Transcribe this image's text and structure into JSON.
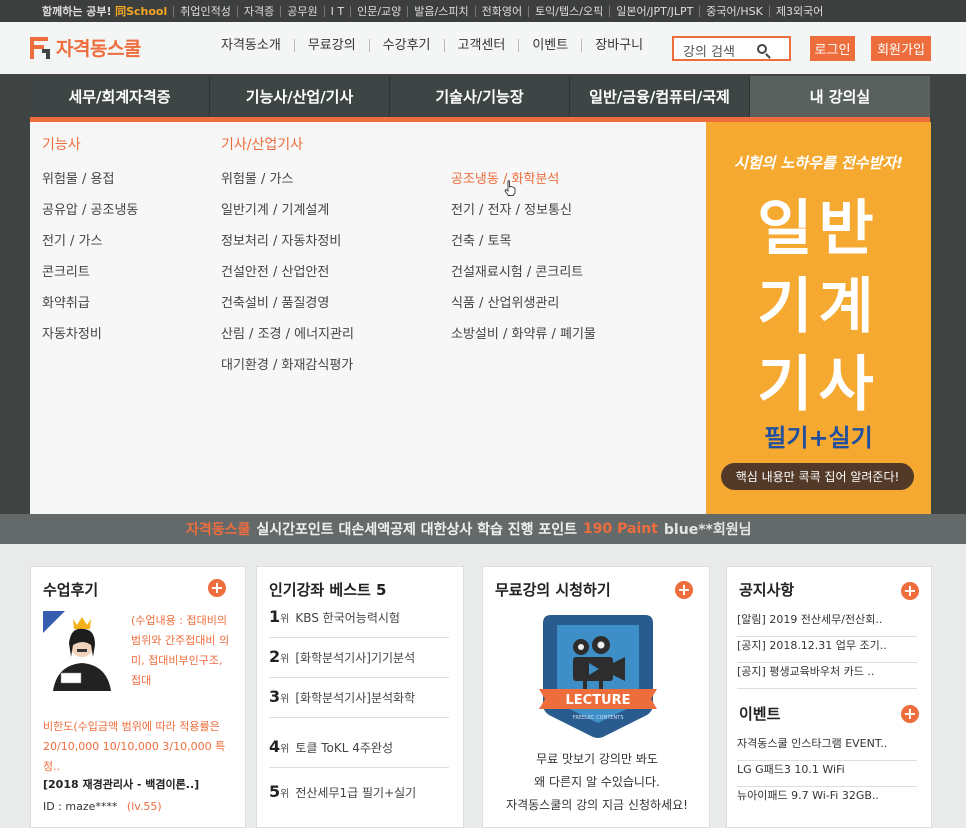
{
  "topbar": {
    "items": [
      "함께하는 공부!",
      "취업인적성",
      "자격증",
      "공무원",
      "I T",
      "인문/교양",
      "발음/스피치",
      "전화영어",
      "토익/텝스/오픽",
      "일본어/JPT/JLPT",
      "중국어/HSK",
      "제3외국어"
    ],
    "brand_hl": "同School"
  },
  "header": {
    "logo": "자격동스쿨",
    "gnb": [
      "자격동소개",
      "무료강의",
      "수강후기",
      "고객센터",
      "이벤트",
      "장바구니"
    ],
    "search_placeholder": "강의 검색",
    "login": "로그인",
    "join": "회원가입"
  },
  "categories": [
    "세무/회계자격증",
    "기능사/산업/기사",
    "기술사/기능장",
    "일반/금융/컴퓨터/국제",
    "내 강의실"
  ],
  "dropdown": {
    "col1_title": "기능사",
    "col1": [
      "위험물 / 용접",
      "공유압 / 공조냉동",
      "전기 / 가스",
      "콘크리트",
      "화약취급",
      "자동차정비"
    ],
    "col2_title": "기사/산업기사",
    "col2": [
      "위험물 / 가스",
      "일반기계 / 기계설계",
      "정보처리 / 자동차정비",
      "건설안전 / 산업안전",
      "건축설비 / 품질경영",
      "산림 / 조경 / 에너지관리",
      "대기환경 / 화재감식평가"
    ],
    "col3": [
      "공조냉동 / 화학분석",
      "전기 / 전자 / 정보통신",
      "건축 / 토목",
      "건설재료시험 / 콘크리트",
      "식품 / 산업위생관리",
      "소방설비 / 화약류 / 폐기물"
    ]
  },
  "banner": {
    "top": "시험의 노하우를 전수받자!",
    "big1": "일반",
    "big2": "기계",
    "big3": "기사",
    "sub": "필기+실기",
    "pill": "핵심 내용만 콕콕 집어 알려준다!"
  },
  "ticker": {
    "brand": "자격동스쿨",
    "text": "실시간포인트 대손세액공제 대한상사 학습 진행 포인트",
    "points": "190 Paint",
    "user": "blue**회원님"
  },
  "review": {
    "title": "수업후기",
    "text1": "(수업내용 : 접대비의 범위와 간주접대비 의미, 접대비부인구조, 접대",
    "text2": "비한도(수입금액 범위에 따라 적용률은20/10,000 10/10,000 3/10,000 특정..",
    "course": "[2018 재경관리사 - 백겸이론..]",
    "id": "ID : maze****",
    "level": "(lv.55)"
  },
  "best": {
    "title": "인기강좌 베스트 5",
    "rank_suffix": "위",
    "items": [
      {
        "rank": "1",
        "name": "KBS 한국어능력시험"
      },
      {
        "rank": "2",
        "name": "[화학분석기사]기기분석"
      },
      {
        "rank": "3",
        "name": "[화학분석기사]분석화학"
      },
      {
        "rank": "4",
        "name": "토클 ToKL 4주완성"
      },
      {
        "rank": "5",
        "name": "전산세무1급 필기+실기"
      }
    ]
  },
  "free": {
    "title": "무료강의 시청하기",
    "badge": "LECTURE",
    "badge_sub": "FREELEC CONTENTS",
    "line1": "무료 맛보기 강의만 봐도",
    "line2": "왜 다른지 알 수있습니다.",
    "line3": "자격동스쿨의 강의 지금 신청하세요!"
  },
  "notice": {
    "title": "공지사항",
    "items": [
      "[알림] 2019 전산세무/전산회..",
      "[공지] 2018.12.31 업무 조기..",
      "[공지] 평생교육바우처 카드 .."
    ],
    "event_title": "이벤트",
    "events": [
      "자격동스쿨 인스타그램 EVENT..",
      "LG G패드3 10.1 WiFi",
      "뉴아이패드 9.7 Wi-Fi 32GB.."
    ]
  },
  "colors": {
    "accent": "#ee6d3d",
    "nav": "#3e4645",
    "banner": "#f6a931"
  }
}
